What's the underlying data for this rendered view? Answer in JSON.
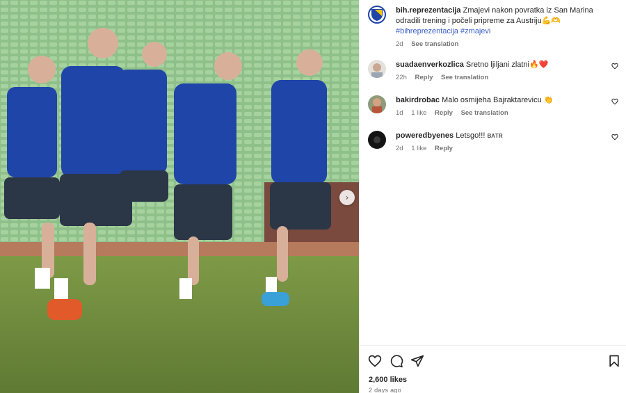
{
  "post": {
    "author": "bih.reprezentacija",
    "caption": "Zmajevi nakon povratka iz San Marina odradili trening i počeli pripreme za Austriju💪🫶",
    "hashtags": "#bihreprezentacija #zmajevi",
    "time": "2d",
    "see_translation": "See translation"
  },
  "comments": [
    {
      "user": "suadaenverkozlica",
      "text": "Sretno ljiljani zlatni🔥❤️",
      "time": "22h",
      "likes": "",
      "reply": "Reply",
      "translate": "See translation",
      "avatar_color": "#d9d4cc"
    },
    {
      "user": "bakirdrobac",
      "text": "Malo osmijeha Bajraktarevicu 👏",
      "time": "1d",
      "likes": "1 like",
      "reply": "Reply",
      "translate": "See translation",
      "avatar_color": "#b6553a"
    },
    {
      "user": "poweredbyenes",
      "text": "Letsgo!!! ʙᴀᴛʀ",
      "time": "2d",
      "likes": "1 like",
      "reply": "Reply",
      "translate": "",
      "avatar_color": "#1a1a1a"
    }
  ],
  "footer": {
    "likes": "2,600 likes",
    "date": "2 days ago"
  },
  "icons": [
    "heart-icon",
    "comment-icon",
    "share-icon",
    "bookmark-icon",
    "chevron-right-icon"
  ]
}
